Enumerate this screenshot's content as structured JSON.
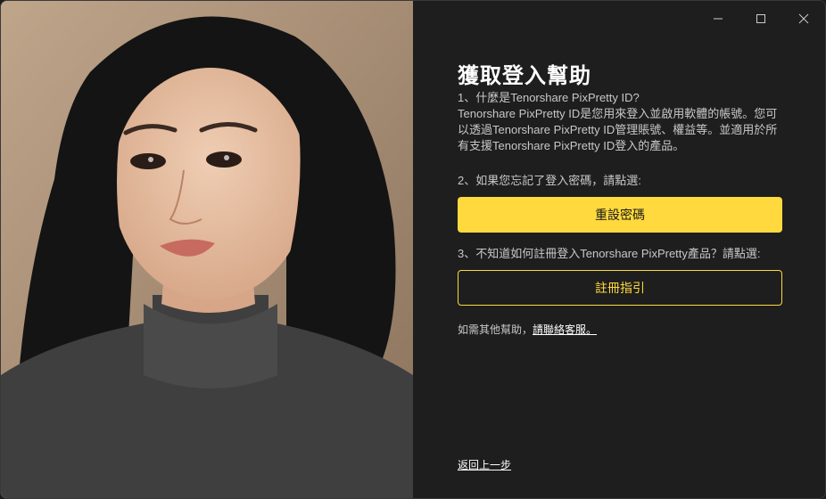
{
  "window_controls": {
    "minimize": "minimize-icon",
    "maximize": "maximize-icon",
    "close": "close-icon"
  },
  "dialog": {
    "title": "獲取登入幫助",
    "q1_heading": "1、什麼是Tenorshare PixPretty ID?",
    "q1_body": "Tenorshare PixPretty ID是您用來登入並啟用軟體的帳號。您可以透過Tenorshare PixPretty ID管理賬號、權益等。並適用於所有支援Tenorshare PixPretty ID登入的產品。",
    "q2_text": "2、如果您忘記了登入密碼，請點選:",
    "reset_button": "重設密碼",
    "q3_text": "3、不知道如何註冊登入Tenorshare PixPretty產品？請點選:",
    "register_button": "註冊指引",
    "help_prefix": "如需其他幫助，",
    "help_link": "請聯絡客服。",
    "back_link": "返回上一步"
  },
  "colors": {
    "accent": "#ffd93d",
    "panel_bg": "#1e1e1e",
    "text": "#c8c8c8"
  }
}
